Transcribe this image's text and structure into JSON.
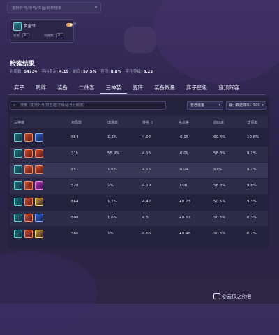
{
  "topbar": {
    "placeholder": "支持外号/拼写/拼音/简称搜索"
  },
  "champion_card": {
    "name": "黄金书",
    "field1_label": "星级",
    "field1_value": "3",
    "field2_label": "装备数",
    "field2_value": "3"
  },
  "results": {
    "title": "检索结果",
    "stats": [
      {
        "label": "对局数:",
        "value": "54724"
      },
      {
        "label": "平均名次:",
        "value": "4.19"
      },
      {
        "label": "前四:",
        "value": "57.5%"
      },
      {
        "label": "登顶:",
        "value": "8.8%"
      },
      {
        "label": "平均等级:",
        "value": "8.22"
      }
    ]
  },
  "tabs": [
    "弈子",
    "羁绊",
    "装备",
    "二件套",
    "三神装",
    "变阵",
    "装备数量",
    "弈子星级",
    "登顶阵容"
  ],
  "active_tab": "三神装",
  "search": {
    "placeholder": "搜索（支持外号/拼音/首字母/逗号分隔搜）"
  },
  "filters": {
    "equip_type": "普通装备",
    "min_sample": "最小数据样本：500"
  },
  "table": {
    "headers": [
      "三神装",
      "对局数",
      "出场率",
      "排名 ⇧",
      "名次差",
      "前四率",
      "登顶率"
    ],
    "rows": [
      {
        "icons": [
          "teal",
          "red",
          "blue"
        ],
        "games": "654",
        "pick": "1.2%",
        "rank": "4.04",
        "diff": "-0.15",
        "top4": "60.4%",
        "win": "10.6%"
      },
      {
        "icons": [
          "teal",
          "red",
          "red"
        ],
        "games": "31k",
        "pick": "55.9%",
        "rank": "4.15",
        "diff": "-0.09",
        "top4": "58.3%",
        "win": "9.1%"
      },
      {
        "icons": [
          "teal",
          "red",
          "red"
        ],
        "games": "851",
        "pick": "1.6%",
        "rank": "4.15",
        "diff": "-0.04",
        "top4": "57%",
        "win": "9.2%"
      },
      {
        "icons": [
          "teal",
          "red",
          "purple"
        ],
        "games": "528",
        "pick": "1%",
        "rank": "4.19",
        "diff": "0.00",
        "top4": "58.3%",
        "win": "9.8%"
      },
      {
        "icons": [
          "teal",
          "red",
          "gold"
        ],
        "games": "664",
        "pick": "1.2%",
        "rank": "4.42",
        "diff": "+0.23",
        "top4": "50.5%",
        "win": "9.3%"
      },
      {
        "icons": [
          "teal",
          "red",
          "blue"
        ],
        "games": "808",
        "pick": "1.6%",
        "rank": "4.5",
        "diff": "+0.32",
        "top4": "50.5%",
        "win": "6.3%"
      },
      {
        "icons": [
          "teal",
          "red",
          "gold"
        ],
        "games": "566",
        "pick": "1%",
        "rank": "4.65",
        "diff": "+0.46",
        "top4": "50.5%",
        "win": "6.2%"
      }
    ]
  },
  "watermark": "@云顶之弈吧"
}
